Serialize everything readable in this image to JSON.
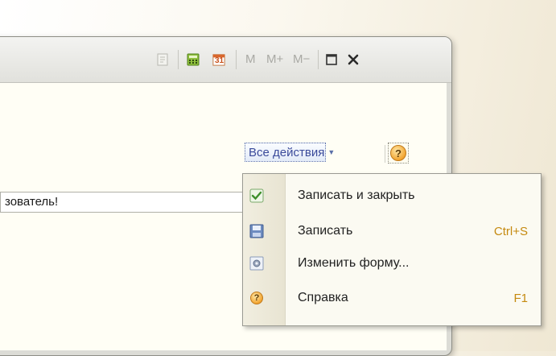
{
  "toolbar": {
    "m_label": "M",
    "m_plus_label": "M+",
    "m_minus_label": "M−",
    "calendar_day": "31"
  },
  "form": {
    "actions_button": "Все действия",
    "text_value": "зователь!"
  },
  "menu": {
    "items": [
      {
        "label": "Записать и закрыть",
        "shortcut": "",
        "icon": "write-close-icon"
      },
      {
        "label": "Записать",
        "shortcut": "Ctrl+S",
        "icon": "save-icon"
      },
      {
        "label": "Изменить форму...",
        "shortcut": "",
        "icon": "form-settings-icon"
      },
      {
        "label": "Справка",
        "shortcut": "F1",
        "icon": "help-icon"
      }
    ]
  },
  "colors": {
    "accent": "#3a4a9a",
    "shortcut": "#c58a10"
  }
}
